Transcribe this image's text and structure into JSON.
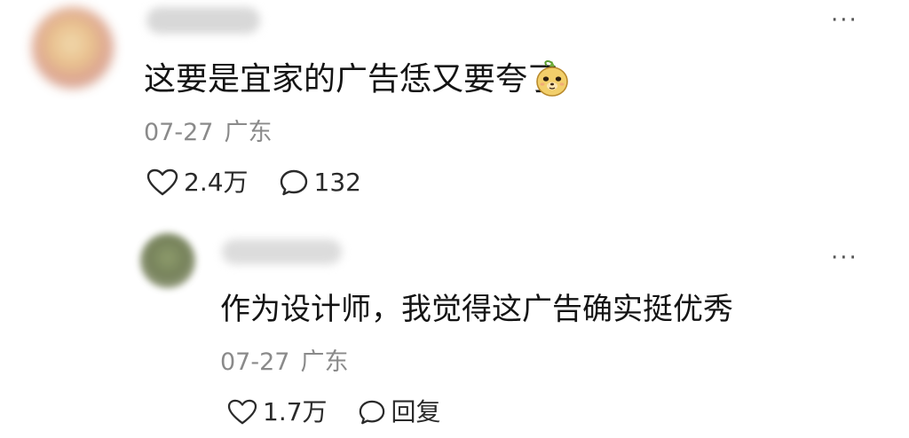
{
  "top_comment": {
    "more_label": "···",
    "text": "这要是宜家的广告恁又要夸了",
    "emoji_icon": "doge-face-emoji",
    "date": "07-27",
    "location": "广东",
    "likes": "2.4万",
    "replies": "132"
  },
  "reply": {
    "more_label": "···",
    "text": "作为设计师，我觉得这广告确实挺优秀",
    "date": "07-27",
    "location": "广东",
    "likes": "1.7万",
    "reply_label": "回复"
  },
  "colors": {
    "text_primary": "#141414",
    "text_meta": "#8a8a8a",
    "icon": "#2a2a2a"
  }
}
